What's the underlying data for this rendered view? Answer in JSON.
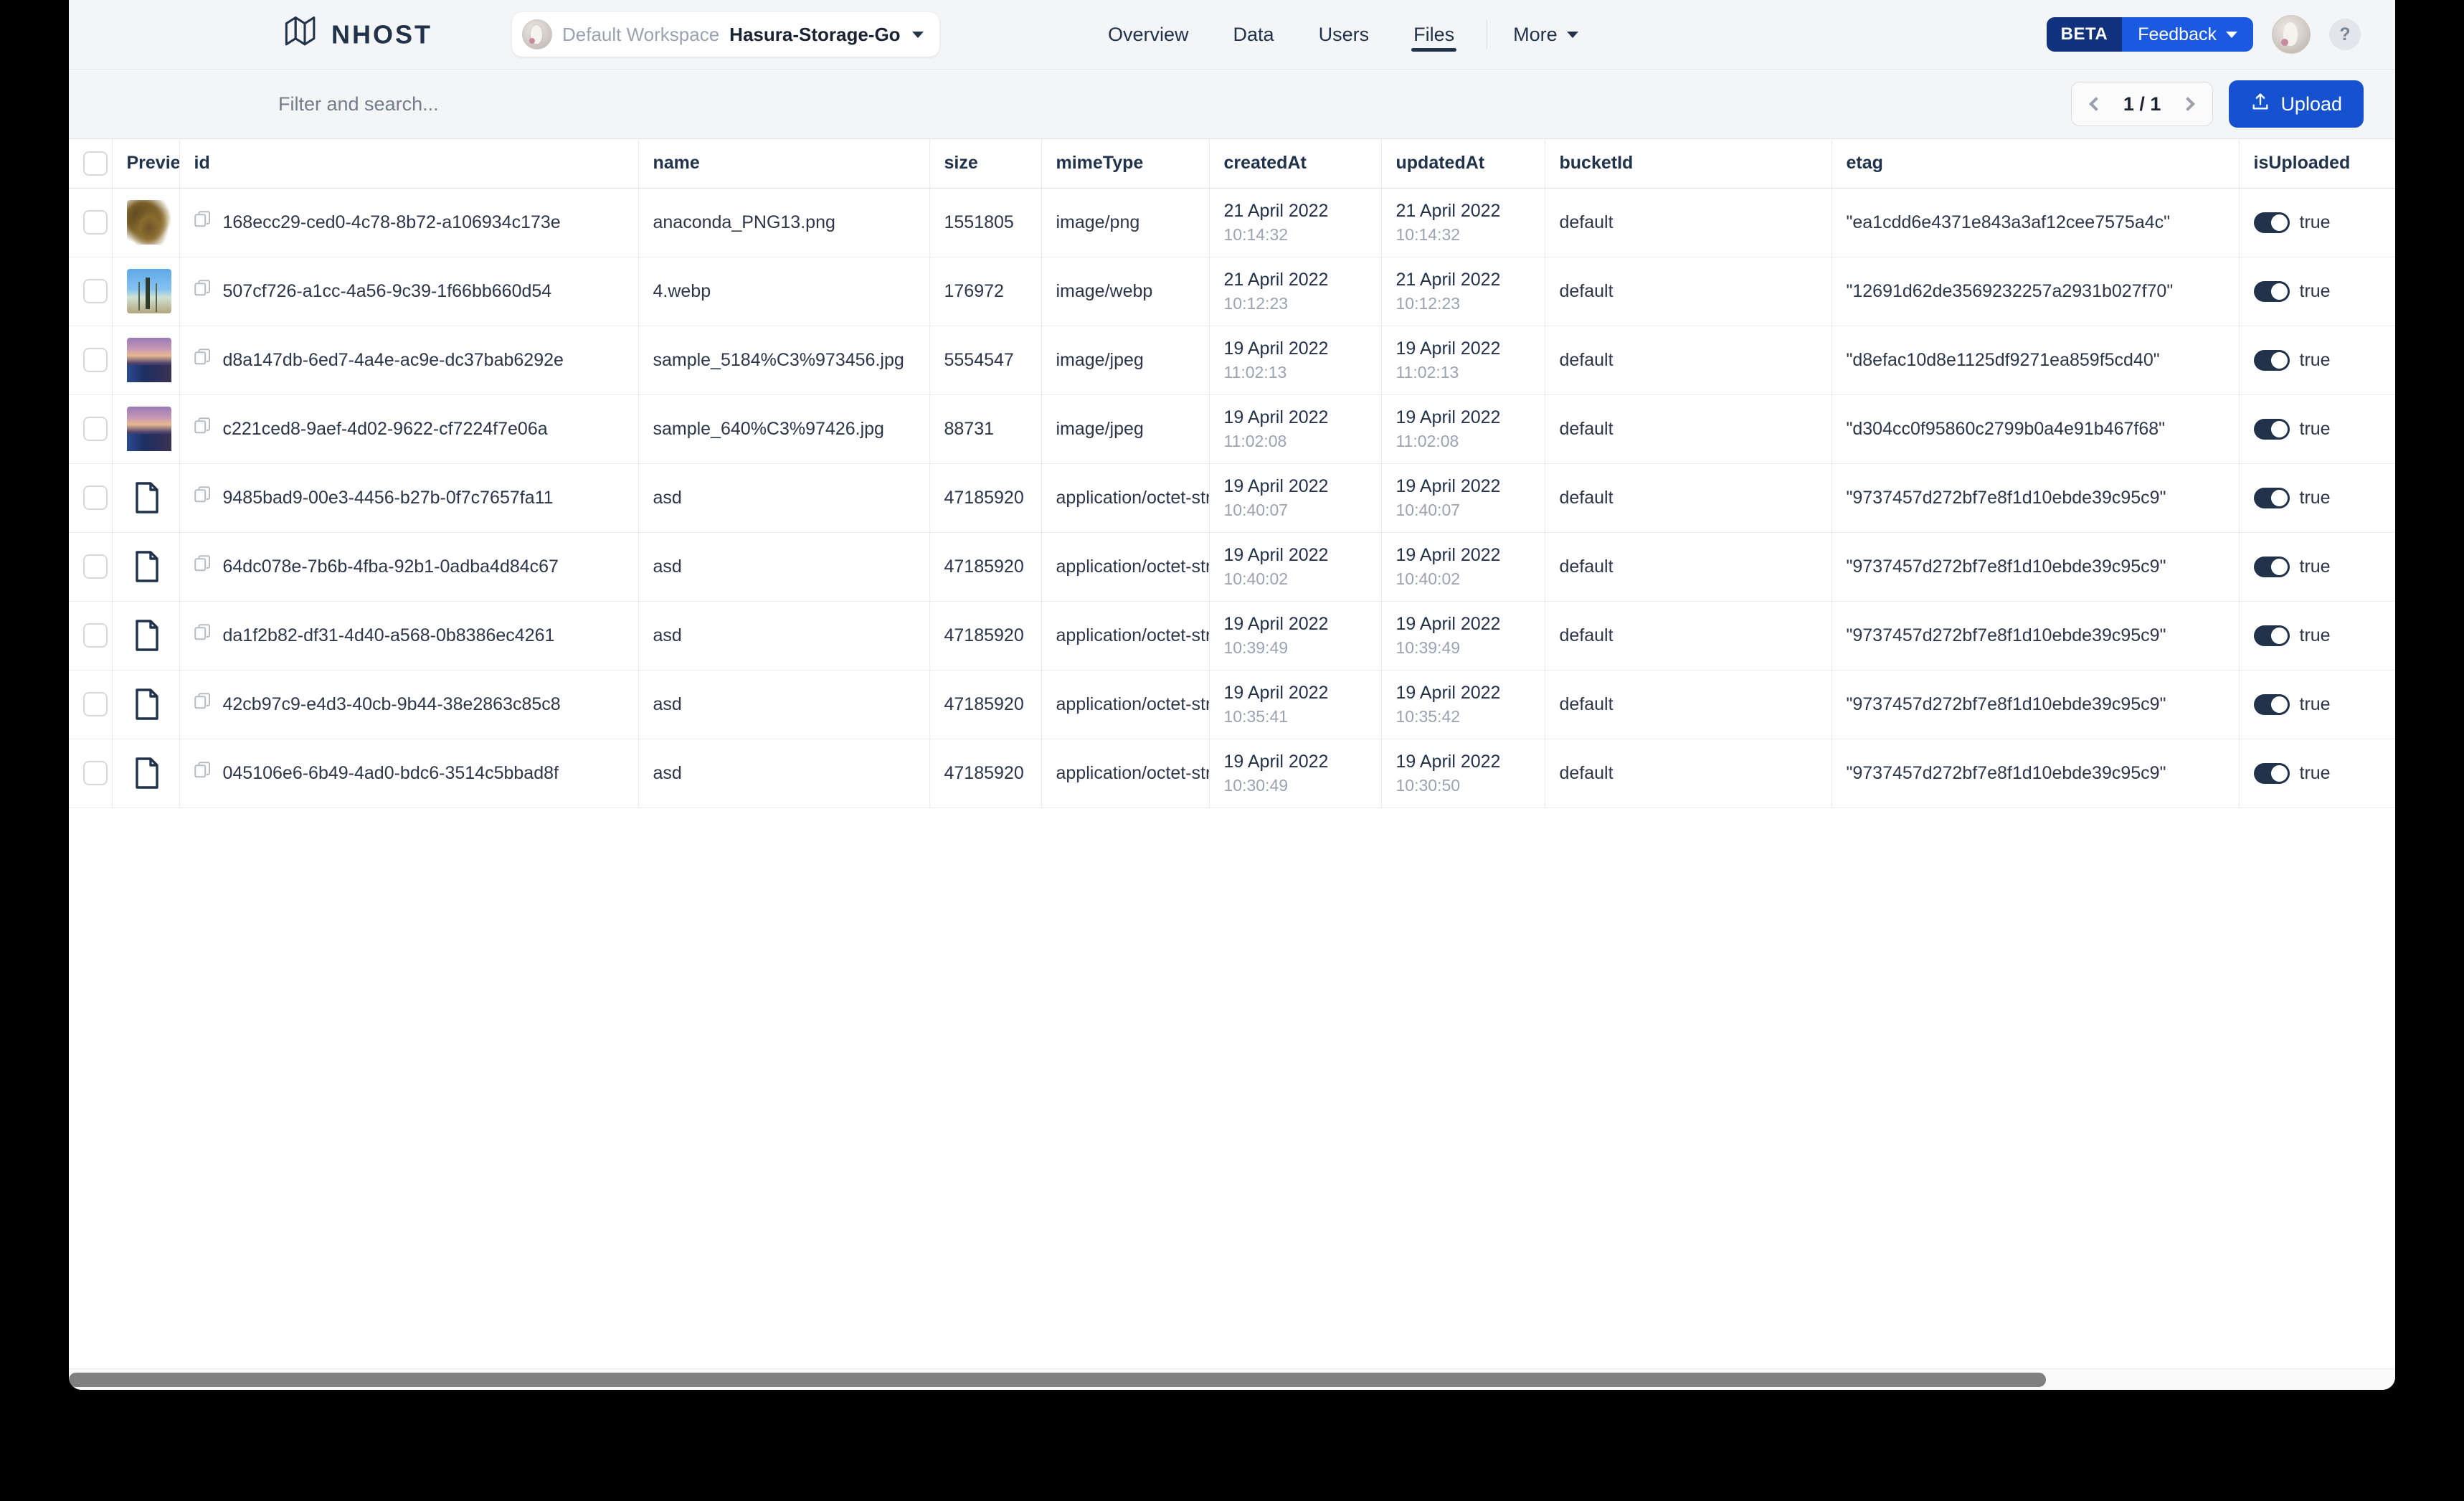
{
  "header": {
    "logo_text": "NHOST",
    "logo_icon": "nhost-logo-icon",
    "workspace_label": "Default Workspace",
    "project_label": "Hasura-Storage-Go",
    "nav": [
      {
        "label": "Overview",
        "active": false
      },
      {
        "label": "Data",
        "active": false
      },
      {
        "label": "Users",
        "active": false
      },
      {
        "label": "Files",
        "active": true
      }
    ],
    "more_label": "More",
    "beta_label": "BETA",
    "feedback_label": "Feedback",
    "help_label": "?"
  },
  "toolbar": {
    "search_placeholder": "Filter and search...",
    "search_value": "",
    "page_label": "1 / 1",
    "prev_icon": "chevron-left-icon",
    "next_icon": "chevron-right-icon",
    "upload_label": "Upload",
    "upload_icon": "upload-icon"
  },
  "table": {
    "columns": [
      {
        "key": "check",
        "label": ""
      },
      {
        "key": "preview",
        "label": "Preview"
      },
      {
        "key": "id",
        "label": "id"
      },
      {
        "key": "name",
        "label": "name"
      },
      {
        "key": "size",
        "label": "size"
      },
      {
        "key": "mime",
        "label": "mimeType"
      },
      {
        "key": "created",
        "label": "createdAt"
      },
      {
        "key": "updated",
        "label": "updatedAt"
      },
      {
        "key": "bucket",
        "label": "bucketId"
      },
      {
        "key": "etag",
        "label": "etag"
      },
      {
        "key": "isup",
        "label": "isUploaded"
      }
    ],
    "rows": [
      {
        "preview_kind": "image-snake",
        "id": "168ecc29-ced0-4c78-8b72-a106934c173e",
        "name": "anaconda_PNG13.png",
        "size": "1551805",
        "mime": "image/png",
        "created_date": "21 April 2022",
        "created_time": "10:14:32",
        "updated_date": "21 April 2022",
        "updated_time": "10:14:32",
        "bucket": "default",
        "etag": "\"ea1cdd6e4371e843a3af12cee7575a4c\"",
        "is_uploaded": "true"
      },
      {
        "preview_kind": "image-tree",
        "id": "507cf726-a1cc-4a56-9c39-1f66bb660d54",
        "name": "4.webp",
        "size": "176972",
        "mime": "image/webp",
        "created_date": "21 April 2022",
        "created_time": "10:12:23",
        "updated_date": "21 April 2022",
        "updated_time": "10:12:23",
        "bucket": "default",
        "etag": "\"12691d62de3569232257a2931b027f70\"",
        "is_uploaded": "true"
      },
      {
        "preview_kind": "image-landscape",
        "id": "d8a147db-6ed7-4a4e-ac9e-dc37bab6292e",
        "name": "sample_5184%C3%973456.jpg",
        "size": "5554547",
        "mime": "image/jpeg",
        "created_date": "19 April 2022",
        "created_time": "11:02:13",
        "updated_date": "19 April 2022",
        "updated_time": "11:02:13",
        "bucket": "default",
        "etag": "\"d8efac10d8e1125df9271ea859f5cd40\"",
        "is_uploaded": "true"
      },
      {
        "preview_kind": "image-landscape",
        "id": "c221ced8-9aef-4d02-9622-cf7224f7e06a",
        "name": "sample_640%C3%97426.jpg",
        "size": "88731",
        "mime": "image/jpeg",
        "created_date": "19 April 2022",
        "created_time": "11:02:08",
        "updated_date": "19 April 2022",
        "updated_time": "11:02:08",
        "bucket": "default",
        "etag": "\"d304cc0f95860c2799b0a4e91b467f68\"",
        "is_uploaded": "true"
      },
      {
        "preview_kind": "document",
        "id": "9485bad9-00e3-4456-b27b-0f7c7657fa11",
        "name": "asd",
        "size": "47185920",
        "mime": "application/octet-stream",
        "created_date": "19 April 2022",
        "created_time": "10:40:07",
        "updated_date": "19 April 2022",
        "updated_time": "10:40:07",
        "bucket": "default",
        "etag": "\"9737457d272bf7e8f1d10ebde39c95c9\"",
        "is_uploaded": "true"
      },
      {
        "preview_kind": "document",
        "id": "64dc078e-7b6b-4fba-92b1-0adba4d84c67",
        "name": "asd",
        "size": "47185920",
        "mime": "application/octet-stream",
        "created_date": "19 April 2022",
        "created_time": "10:40:02",
        "updated_date": "19 April 2022",
        "updated_time": "10:40:02",
        "bucket": "default",
        "etag": "\"9737457d272bf7e8f1d10ebde39c95c9\"",
        "is_uploaded": "true"
      },
      {
        "preview_kind": "document",
        "id": "da1f2b82-df31-4d40-a568-0b8386ec4261",
        "name": "asd",
        "size": "47185920",
        "mime": "application/octet-stream",
        "created_date": "19 April 2022",
        "created_time": "10:39:49",
        "updated_date": "19 April 2022",
        "updated_time": "10:39:49",
        "bucket": "default",
        "etag": "\"9737457d272bf7e8f1d10ebde39c95c9\"",
        "is_uploaded": "true"
      },
      {
        "preview_kind": "document",
        "id": "42cb97c9-e4d3-40cb-9b44-38e2863c85c8",
        "name": "asd",
        "size": "47185920",
        "mime": "application/octet-stream",
        "created_date": "19 April 2022",
        "created_time": "10:35:41",
        "updated_date": "19 April 2022",
        "updated_time": "10:35:42",
        "bucket": "default",
        "etag": "\"9737457d272bf7e8f1d10ebde39c95c9\"",
        "is_uploaded": "true"
      },
      {
        "preview_kind": "document",
        "id": "045106e6-6b49-4ad0-bdc6-3514c5bbad8f",
        "name": "asd",
        "size": "47185920",
        "mime": "application/octet-stream",
        "created_date": "19 April 2022",
        "created_time": "10:30:49",
        "updated_date": "19 April 2022",
        "updated_time": "10:30:50",
        "bucket": "default",
        "etag": "\"9737457d272bf7e8f1d10ebde39c95c9\"",
        "is_uploaded": "true"
      }
    ]
  },
  "colors": {
    "brand_navy": "#21324b",
    "accent_blue": "#1652cf",
    "beta_navy": "#13327e",
    "feedback_blue": "#1b5ae0",
    "header_bg": "#f4f5f7"
  }
}
